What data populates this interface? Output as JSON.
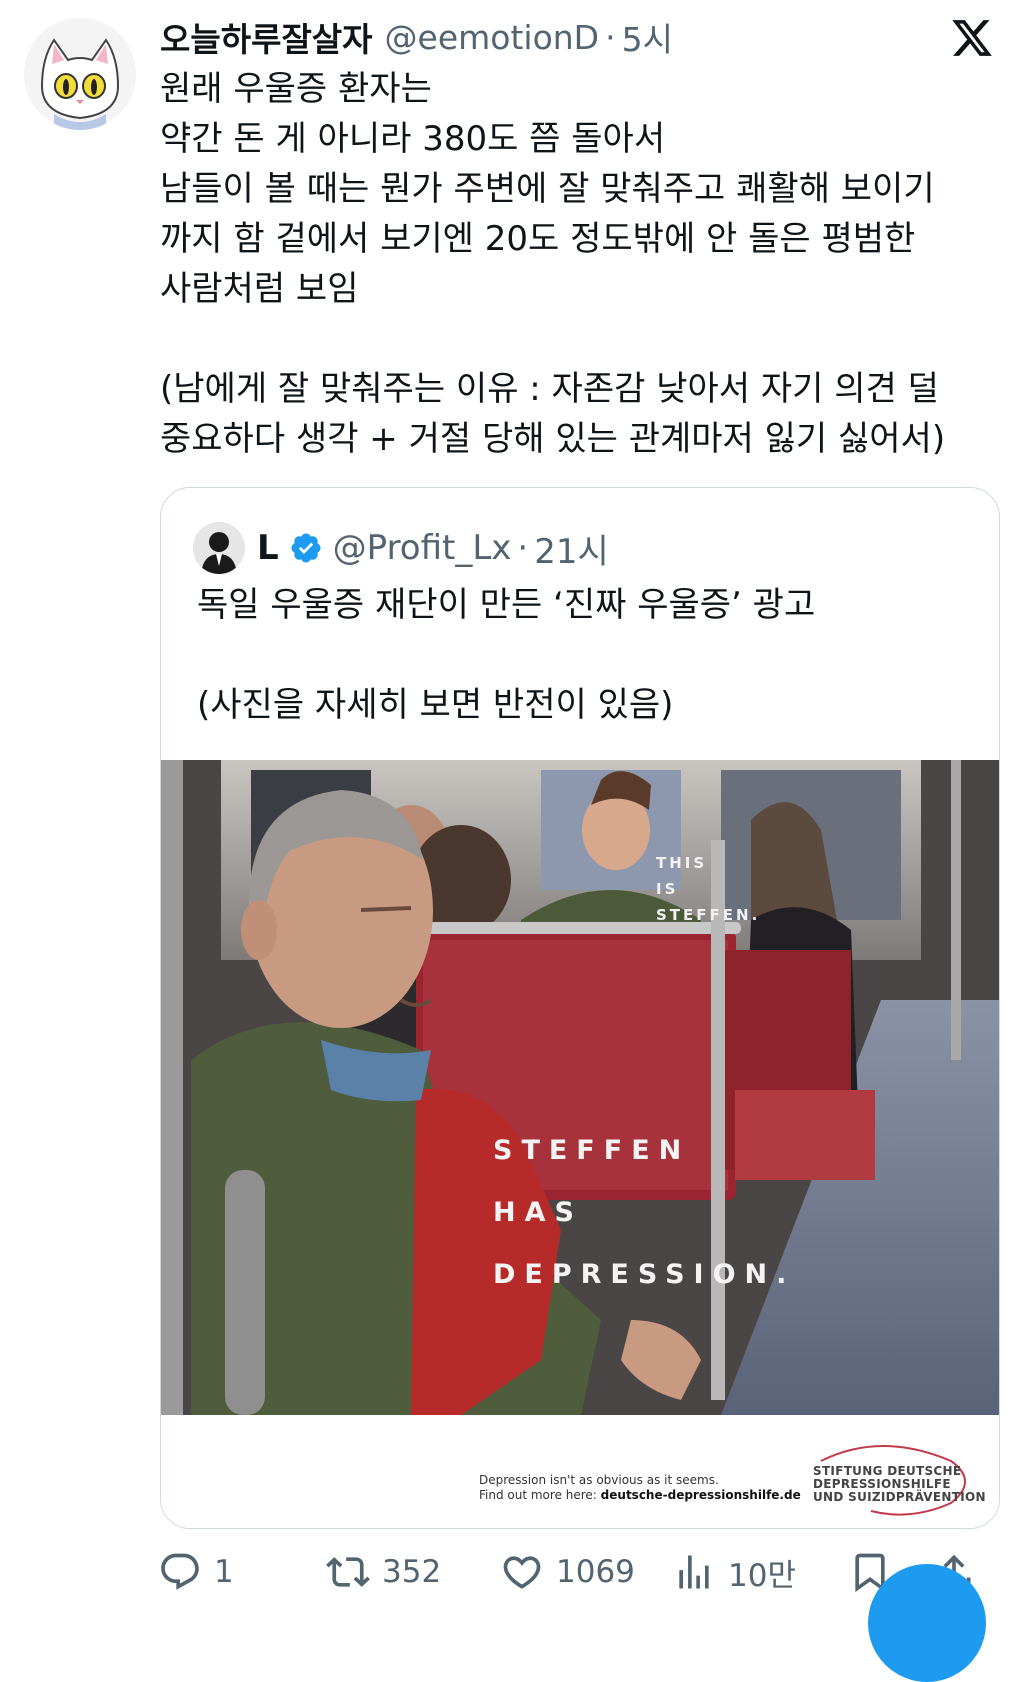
{
  "tweet": {
    "display_name": "오늘하루잘살자",
    "handle": "@eemotionD",
    "separator": "·",
    "time": "5시",
    "text": "원래 우울증 환자는\n약간 돈 게 아니라 380도 쯤 돌아서\n남들이 볼 때는 뭔가 주변에 잘 맞춰주고 쾌활해 보이기\n까지 함 겉에서 보기엔 20도 정도밖에 안 돌은 평범한\n사람처럼 보임\n\n(남에게 잘 맞춰주는 이유 : 자존감 낮아서 자기 의견 덜\n중요하다 생각 + 거절 당해 있는 관계마저 잃기 싫어서)"
  },
  "quote": {
    "display_name": "L",
    "handle": "@Profit_Lx",
    "separator": "·",
    "time": "21시",
    "text": "독일 우울증 재단이 만든 ‘진짜 우울증’ 광고\n\n(사진을 자세히 보면 반전이 있음)",
    "ad": {
      "small_caption": "THIS\nIS\nSTEFFEN.",
      "big_caption": "STEFFEN\nHAS\nDEPRESSION.",
      "footer_line1": "Depression isn't as obvious as it seems.",
      "footer_line2_prefix": "Find out more here: ",
      "footer_url": "deutsche-depressionshilfe.de",
      "foundation": "STIFTUNG DEUTSCHE\nDEPRESSIONSHILFE\nUND SUIZIDPRÄVENTION"
    }
  },
  "actions": {
    "replies": "1",
    "retweets": "352",
    "likes": "1069",
    "views": "10만"
  },
  "colors": {
    "text": "#0f1419",
    "secondary": "#536471",
    "border": "#cfd9de",
    "verified": "#1d9bf0",
    "fab": "#1d9bf0"
  },
  "icons": [
    "x-logo-icon",
    "verified-badge-icon",
    "reply-icon",
    "retweet-icon",
    "like-icon",
    "views-icon",
    "bookmark-icon",
    "share-icon"
  ]
}
